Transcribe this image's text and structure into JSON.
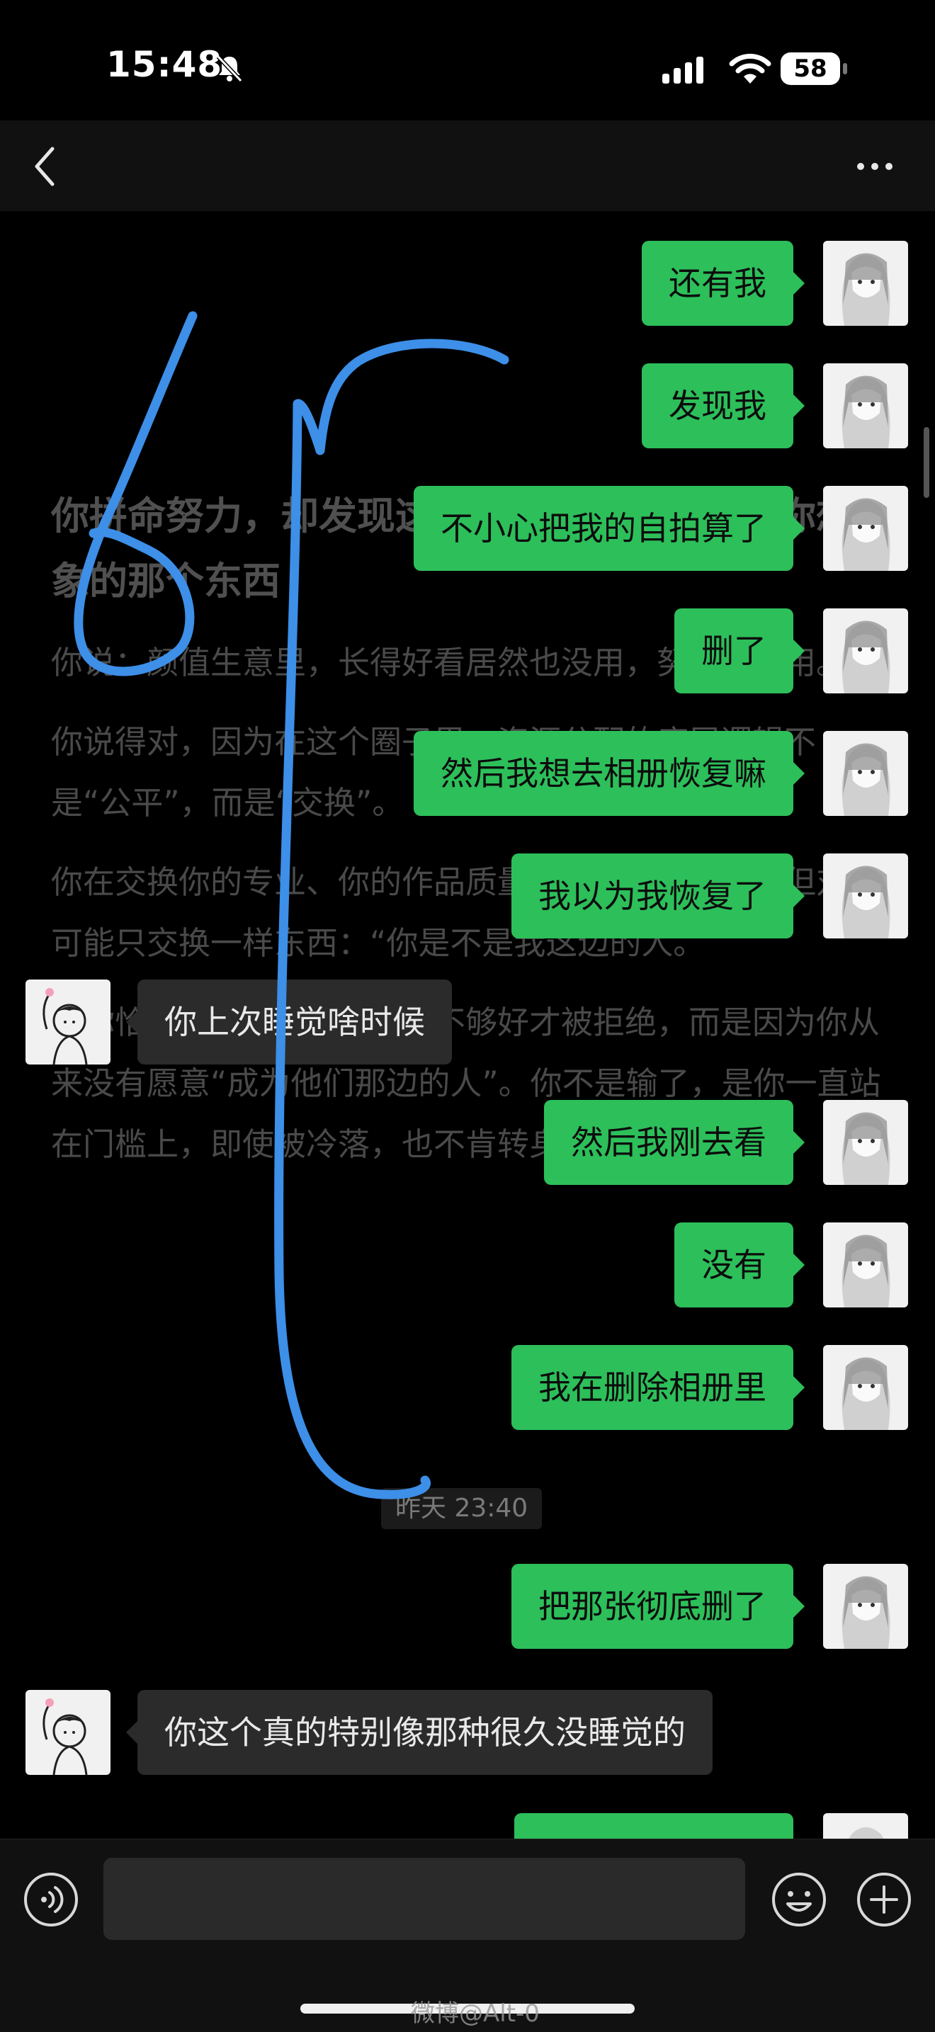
{
  "status_bar": {
    "time": "15:48",
    "battery": "58"
  },
  "nav": {
    "title": ""
  },
  "background_article": {
    "heading": "你拼命努力，却发现这个圈子里的规则不是你想象的那个东西",
    "paragraphs": [
      "你说：颜值生意里，长得好看居然也没用，努力也没用。",
      "你说得对，因为在这个圈子里，资源分配的底层逻辑不是“公平”，而是“交换”。",
      "你在交换你的专业、你的作品质量、你的粉丝粘性。但对方可能只交换一样东西：“你是不是我这边的人。”",
      "而你恰恰不是。你不是因为不够好才被拒绝，而是因为你从来没有愿意“成为他们那边的人”。你不是输了，是你一直站在门槛上，即使被冷落，也不肯转身离开。"
    ]
  },
  "messages": [
    {
      "side": "out",
      "text": "还有我"
    },
    {
      "side": "out",
      "text": "发现我"
    },
    {
      "side": "out",
      "text": "不小心把我的自拍算了"
    },
    {
      "side": "out",
      "text": "删了"
    },
    {
      "side": "out",
      "text": "然后我想去相册恢复嘛"
    },
    {
      "side": "out",
      "text": "我以为我恢复了"
    },
    {
      "side": "in",
      "text": "你上次睡觉啥时候"
    },
    {
      "side": "out",
      "text": "然后我刚去看"
    },
    {
      "side": "out",
      "text": "没有"
    },
    {
      "side": "out",
      "text": "我在删除相册里"
    },
    {
      "side": "time",
      "text": "昨天 23:40"
    },
    {
      "side": "out",
      "text": "把那张彻底删了"
    },
    {
      "side": "in",
      "text": "你这个真的特别像那种很久没睡觉的"
    }
  ],
  "input_bar": {
    "placeholder": ""
  },
  "watermark": "微博@Alt-0",
  "icons": {
    "back": "chevron-left-icon",
    "more": "more-icon",
    "voice": "voice-icon",
    "emoji": "emoji-icon",
    "add": "plus-icon"
  },
  "colors": {
    "outgoing_bubble": "#2dbf5a",
    "incoming_bubble": "#2b2b2b",
    "annotation_stroke": "#3d8fe8",
    "background": "#000000"
  }
}
